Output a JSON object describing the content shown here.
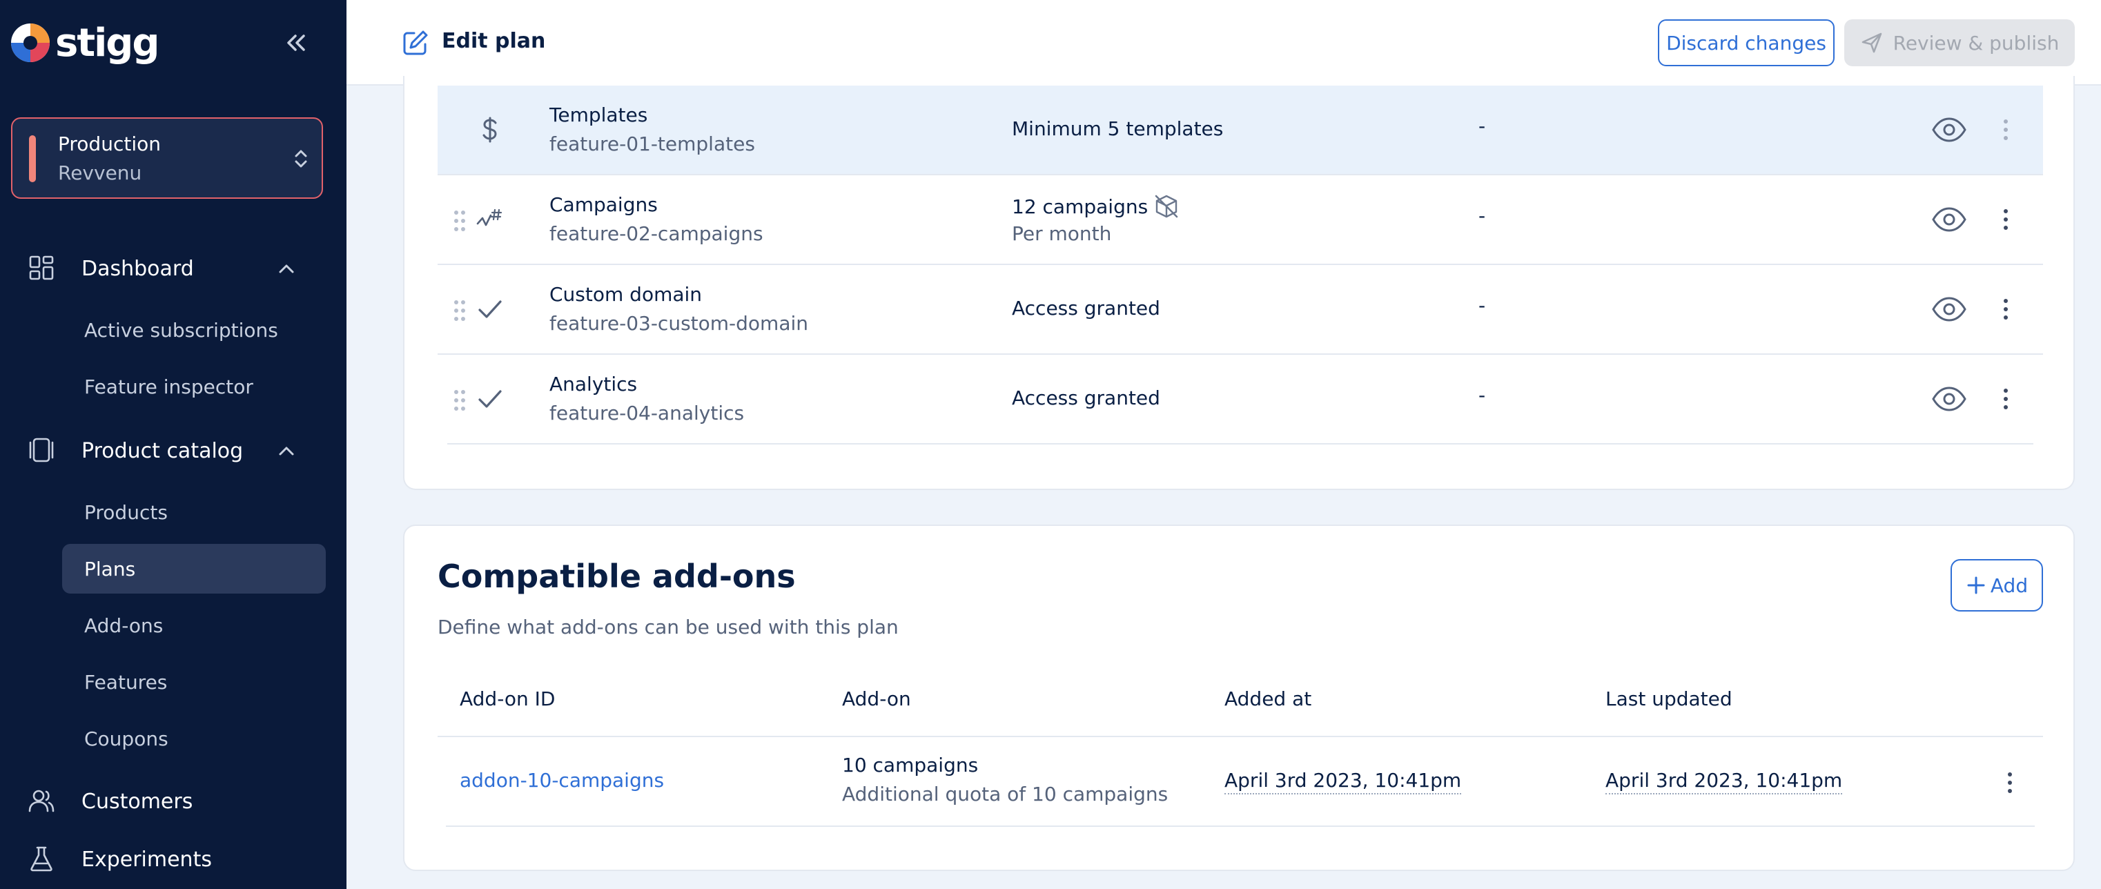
{
  "app": {
    "logo_text": "stigg"
  },
  "environment": {
    "name": "Production",
    "account": "Revvenu"
  },
  "sidebar": {
    "sections": [
      {
        "label": "Dashboard",
        "icon": "dashboard-icon",
        "expanded": true,
        "items": [
          {
            "label": "Active subscriptions"
          },
          {
            "label": "Feature inspector"
          }
        ]
      },
      {
        "label": "Product catalog",
        "icon": "catalog-icon",
        "expanded": true,
        "items": [
          {
            "label": "Products"
          },
          {
            "label": "Plans",
            "active": true
          },
          {
            "label": "Add-ons"
          },
          {
            "label": "Features"
          },
          {
            "label": "Coupons"
          }
        ]
      },
      {
        "label": "Customers",
        "icon": "users-icon"
      },
      {
        "label": "Experiments",
        "icon": "flask-icon"
      }
    ]
  },
  "header": {
    "title": "Edit plan",
    "discard_label": "Discard changes",
    "publish_label": "Review & publish"
  },
  "features": [
    {
      "name": "Templates",
      "id": "feature-01-templates",
      "value": "Minimum 5 templates",
      "extra": "-",
      "icon": "dollar-icon"
    },
    {
      "name": "Campaigns",
      "id": "feature-02-campaigns",
      "value": "12 campaigns",
      "value_sub": "Per month",
      "extra": "-",
      "icon": "metered-icon"
    },
    {
      "name": "Custom domain",
      "id": "feature-03-custom-domain",
      "value": "Access granted",
      "extra": "-",
      "icon": "check-icon"
    },
    {
      "name": "Analytics",
      "id": "feature-04-analytics",
      "value": "Access granted",
      "extra": "-",
      "icon": "check-icon"
    }
  ],
  "addons": {
    "title": "Compatible add-ons",
    "subtitle": "Define what add-ons can be used with this plan",
    "add_label": "Add",
    "columns": [
      "Add-on ID",
      "Add-on",
      "Added at",
      "Last updated"
    ],
    "rows": [
      {
        "id": "addon-10-campaigns",
        "name": "10 campaigns",
        "description": "Additional quota of 10 campaigns",
        "added_at": "April 3rd 2023, 10:41pm",
        "updated_at": "April 3rd 2023, 10:41pm"
      }
    ]
  },
  "colors": {
    "sidebar_bg": "#0a1a3a",
    "accent": "#2f6fd6",
    "env_border": "#e2626a"
  }
}
